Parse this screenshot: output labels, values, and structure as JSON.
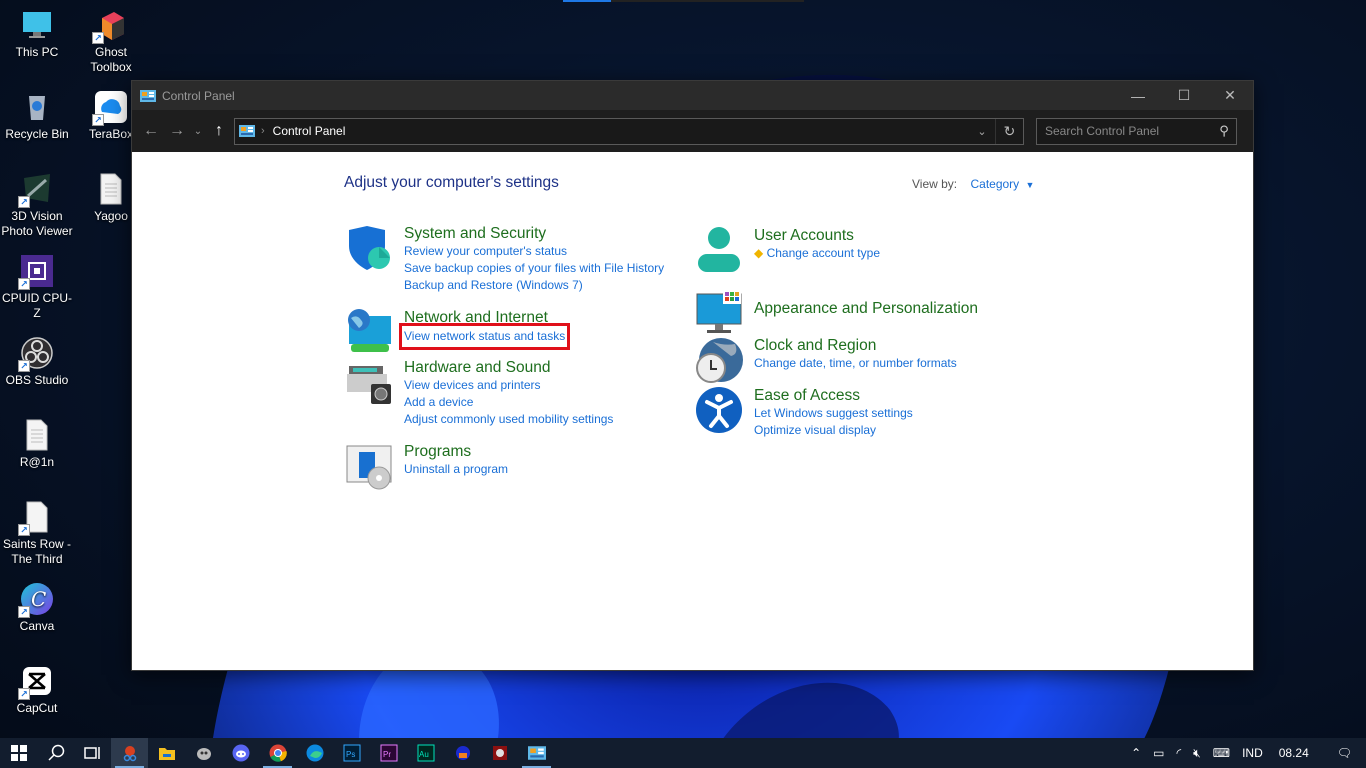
{
  "desktop": {
    "icons": [
      {
        "label": "This PC",
        "icon": "monitor-icon"
      },
      {
        "label": "Ghost Toolbox",
        "icon": "ghost-toolbox-icon"
      },
      {
        "label": "Recycle Bin",
        "icon": "recycle-bin-icon"
      },
      {
        "label": "TeraBox",
        "icon": "terabox-icon"
      },
      {
        "label": "3D Vision Photo Viewer",
        "icon": "3d-vision-icon"
      },
      {
        "label": "Yagoo",
        "icon": "document-icon"
      },
      {
        "label": "CPUID CPU-Z",
        "icon": "cpu-z-icon"
      },
      {
        "label": "OBS Studio",
        "icon": "obs-icon"
      },
      {
        "label": "R@1n",
        "icon": "document-icon"
      },
      {
        "label": "Saints Row - The Third",
        "icon": "document-icon"
      },
      {
        "label": "Canva",
        "icon": "canva-icon"
      },
      {
        "label": "CapCut",
        "icon": "capcut-icon"
      }
    ]
  },
  "window": {
    "title": "Control Panel",
    "controls": {
      "minimize": "—",
      "maximize": "☐",
      "close": "✕"
    },
    "nav": {
      "back": "←",
      "forward": "→",
      "recent": "⌄",
      "up": "↑"
    },
    "address": {
      "crumb": "Control Panel",
      "separator": "›",
      "dropdown": "⌄",
      "refresh": "↻"
    },
    "search": {
      "placeholder": "Search Control Panel",
      "value": "",
      "icon": "🔍"
    }
  },
  "content": {
    "heading": "Adjust your computer's settings",
    "view_by": {
      "label": "View by:",
      "selected": "Category",
      "caret": "▼"
    },
    "categories_left": [
      {
        "title": "System and Security",
        "icon": "shield-icon",
        "links": [
          "Review your computer's status",
          "Save backup copies of your files with File History",
          "Backup and Restore (Windows 7)"
        ]
      },
      {
        "title": "Network and Internet",
        "icon": "network-icon",
        "links": [
          "View network status and tasks"
        ],
        "highlighted_link": 0
      },
      {
        "title": "Hardware and Sound",
        "icon": "printer-icon",
        "links": [
          "View devices and printers",
          "Add a device",
          "Adjust commonly used mobility settings"
        ]
      },
      {
        "title": "Programs",
        "icon": "programs-icon",
        "links": [
          "Uninstall a program"
        ]
      }
    ],
    "categories_right": [
      {
        "title": "User Accounts",
        "icon": "user-icon",
        "links": [
          "Change account type"
        ],
        "link_icon": "uac-shield-icon"
      },
      {
        "title": "Appearance and Personalization",
        "icon": "appearance-icon",
        "links": []
      },
      {
        "title": "Clock and Region",
        "icon": "clock-globe-icon",
        "links": [
          "Change date, time, or number formats"
        ]
      },
      {
        "title": "Ease of Access",
        "icon": "accessibility-icon",
        "links": [
          "Let Windows suggest settings",
          "Optimize visual display"
        ]
      }
    ]
  },
  "taskbar": {
    "apps": [
      "start",
      "search",
      "task-view",
      "snipping-tool",
      "file-explorer",
      "ghost-app",
      "discord",
      "chrome",
      "edge",
      "photoshop",
      "premiere",
      "audition",
      "app-blue",
      "app-red",
      "control-panel"
    ],
    "tray": {
      "language": "IND",
      "time": "08.24"
    }
  },
  "colors": {
    "link": "#1a6fd6",
    "category_title": "#1e6e1e",
    "heading": "#1e3287",
    "highlight": "#e0101a"
  }
}
